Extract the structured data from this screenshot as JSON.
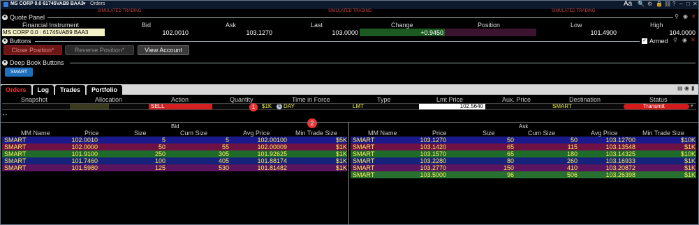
{
  "window": {
    "title": "MS CORP 0.0 61745VAB9 BAA3",
    "menu_orders": "Orders",
    "sim_label": "SIMULATED TRADING",
    "aa": "Aa"
  },
  "quote_panel": {
    "title": "Quote Panel",
    "headers": {
      "instrument": "Financial Instrument",
      "bid": "Bid",
      "ask": "Ask",
      "last": "Last",
      "change": "Change",
      "position": "Position",
      "low": "Low",
      "high": "High"
    },
    "values": {
      "instrument": "MS CORP 0.0 61745VAB9 BAA3",
      "instrument_short": "MS CORP 0.0",
      "bid": "102.0010",
      "ask": "103.1270",
      "last": "103.0000",
      "change": "+0.9450",
      "position": "",
      "low": "101.4900",
      "high": "104.0000"
    }
  },
  "buttons_panel": {
    "title": "Buttons",
    "close_position": "Close Position*",
    "reverse_position": "Reverse Position*",
    "view_account": "View Account",
    "armed": "Armed"
  },
  "deep_book_buttons": {
    "title": "Deep Book Buttons",
    "smart": "SMART"
  },
  "tabs": [
    "Orders",
    "Log",
    "Trades",
    "Portfolio"
  ],
  "orders": {
    "headers": [
      "Snapshot",
      "Allocation",
      "Action",
      "Quantity",
      "Time in Force",
      "Type",
      "Lmt Price",
      "Aux. Price",
      "Destination",
      "Status"
    ],
    "row": {
      "action": "SELL",
      "badge1": "1",
      "quantity": "$1K",
      "tif": "DAY",
      "type": "LMT",
      "lmt_price": "102.5640",
      "destination": "SMART",
      "status": "Transmit"
    },
    "badge2": "2"
  },
  "book": {
    "bid_title": "Bid",
    "ask_title": "Ask",
    "headers": [
      "MM Name",
      "Price",
      "Size",
      "Cum Size",
      "Avg Price",
      "Min Trade Size"
    ],
    "bid_rows": [
      [
        "SMART",
        "102.0010",
        "5",
        "5",
        "102.00100",
        "$5K"
      ],
      [
        "SMART",
        "102.0000",
        "50",
        "55",
        "102.00009",
        "$1K"
      ],
      [
        "SMART",
        "101.9100",
        "250",
        "305",
        "101.92625",
        "$1K"
      ],
      [
        "SMART",
        "101.7460",
        "100",
        "405",
        "101.88174",
        "$1K"
      ],
      [
        "SMART",
        "101.5980",
        "125",
        "530",
        "101.81482",
        "$1K"
      ]
    ],
    "ask_rows": [
      [
        "SMART",
        "103.1270",
        "50",
        "50",
        "103.12700",
        "$10K"
      ],
      [
        "SMART",
        "103.1420",
        "65",
        "115",
        "103.13548",
        "$1K"
      ],
      [
        "SMART",
        "103.1570",
        "65",
        "180",
        "103.14325",
        "$10K"
      ],
      [
        "SMART",
        "103.2280",
        "80",
        "260",
        "103.16933",
        "$1K"
      ],
      [
        "SMART",
        "103.2770",
        "150",
        "410",
        "103.20872",
        "$1K"
      ],
      [
        "SMART",
        "103.5000",
        "96",
        "506",
        "103.26398",
        "$1K"
      ]
    ],
    "row_colors": [
      "#1a1a8c",
      "#6e1245",
      "#1f6b2a",
      "#17237a",
      "#5a1460",
      "#27702f"
    ]
  }
}
